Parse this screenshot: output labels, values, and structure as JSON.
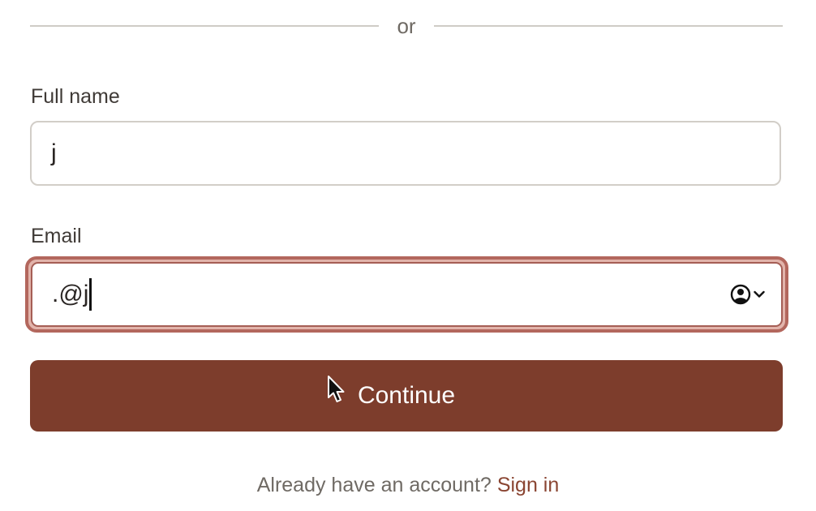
{
  "divider": {
    "text": "or"
  },
  "full_name": {
    "label": "Full name",
    "value": "j"
  },
  "email": {
    "label": "Email",
    "value": ".@j",
    "state": "error",
    "autofill_icon": "user-circle-icon"
  },
  "continue_button": {
    "label": "Continue"
  },
  "signin": {
    "prompt": "Already have an account?",
    "link_label": "Sign in"
  },
  "colors": {
    "brand": "#7d3d2c",
    "error_border": "#b3675d",
    "link": "#8a4532",
    "border": "#d2cec8"
  }
}
